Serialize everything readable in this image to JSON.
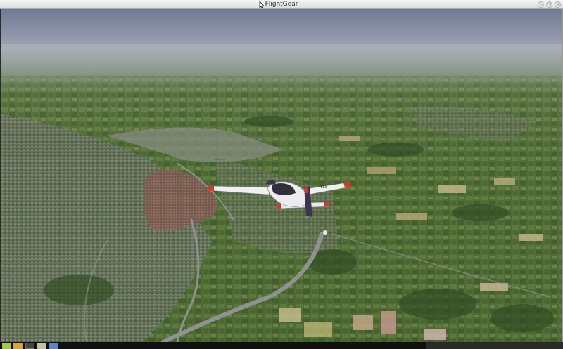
{
  "window": {
    "title": "FlightGear"
  },
  "scene": {
    "description_icon": "aircraft-view",
    "aircraft": {
      "tail_number": "415",
      "livery_colors": {
        "body": "#f0f0f2",
        "accent": "#d8372b",
        "tail": "#3b3550"
      }
    },
    "sky_color": "#7f8aa3",
    "haze_color": "#aab0ba",
    "terrain_color": "#4f6a35"
  },
  "taskbar": {
    "icons": [
      {
        "name": "menu-icon",
        "color": "#a6c93c"
      },
      {
        "name": "files-icon",
        "color": "#e0a236"
      },
      {
        "name": "terminal-icon",
        "color": "#444444"
      },
      {
        "name": "folder-icon",
        "color": "#c9c0a4"
      },
      {
        "name": "browser-icon",
        "color": "#5d86c5"
      }
    ]
  }
}
